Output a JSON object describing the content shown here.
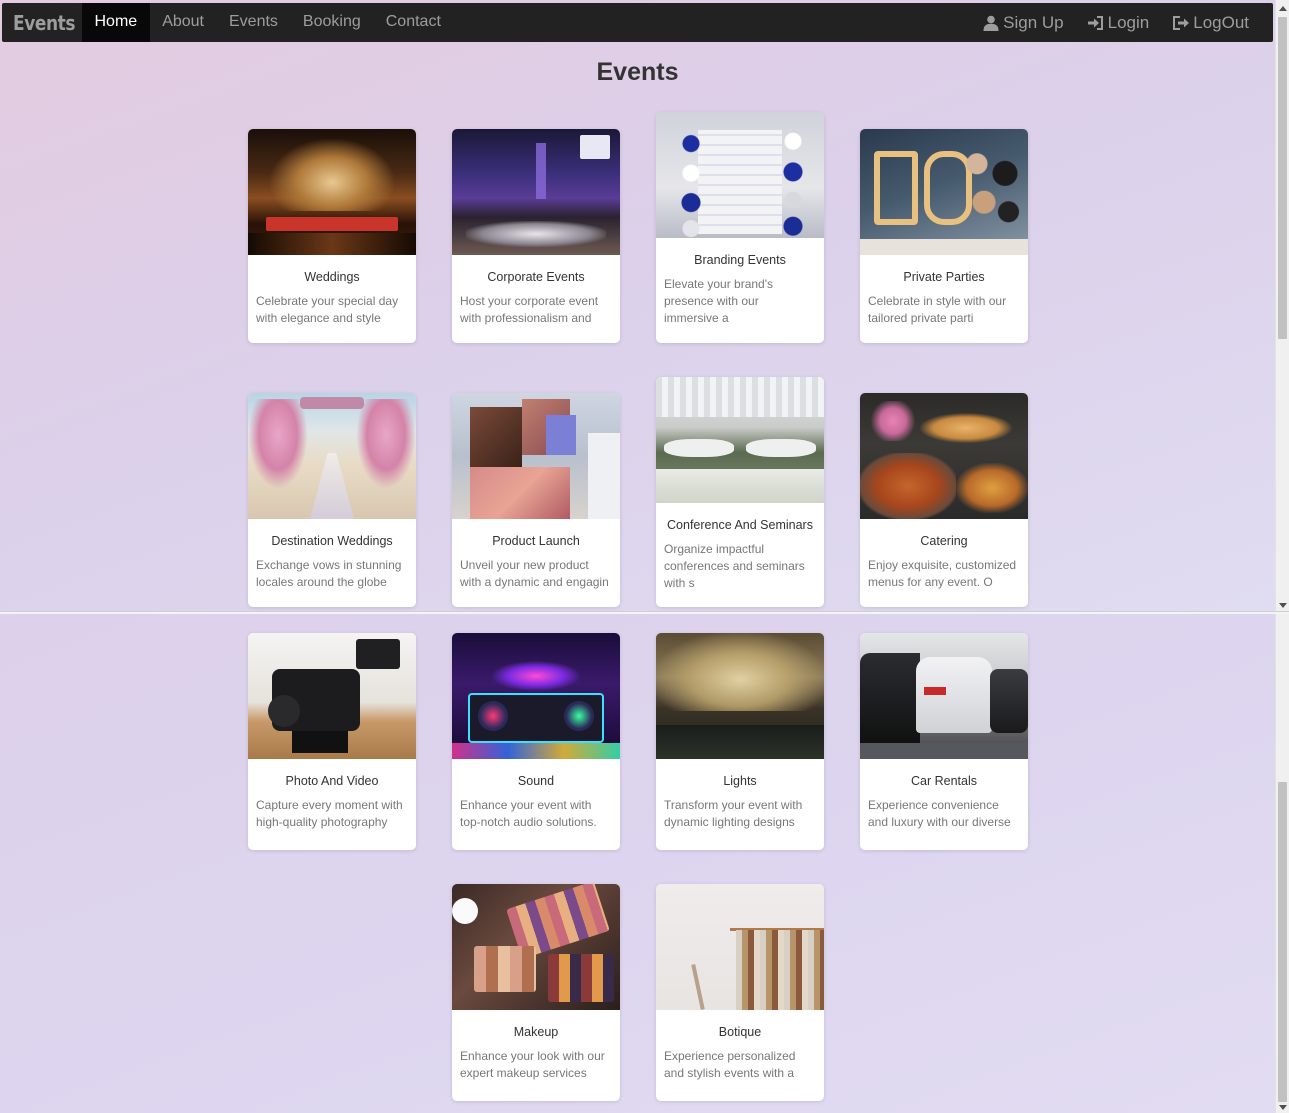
{
  "nav": {
    "brand": "Events",
    "links": [
      "Home",
      "About",
      "Events",
      "Booking",
      "Contact"
    ],
    "active": "Home",
    "right": [
      {
        "label": "Sign Up",
        "icon": "user-icon"
      },
      {
        "label": "Login",
        "icon": "login-icon"
      },
      {
        "label": "LogOut",
        "icon": "logout-icon"
      }
    ]
  },
  "page": {
    "title": "Events"
  },
  "cards": [
    {
      "title": "Weddings",
      "desc": "Celebrate your special day with elegance and style",
      "image": "wedding-stage-image"
    },
    {
      "title": "Corporate Events",
      "desc": "Host your corporate event with professionalism and",
      "image": "corporate-hall-image"
    },
    {
      "title": "Branding Events",
      "desc": "Elevate your brand's presence with our immersive a",
      "image": "balloon-backdrop-image"
    },
    {
      "title": "Private Parties",
      "desc": "Celebrate in style with our tailored private parti",
      "image": "party-balloons-image"
    },
    {
      "title": "Destination Weddings",
      "desc": "Exchange vows in stunning locales around the globe",
      "image": "beach-wedding-image"
    },
    {
      "title": "Product Launch",
      "desc": "Unveil your new product with a dynamic and engagin",
      "image": "product-launch-image"
    },
    {
      "title": "Conference And Seminars",
      "desc": "Organize impactful conferences and seminars with s",
      "image": "conference-room-image"
    },
    {
      "title": "Catering",
      "desc": "Enjoy exquisite, customized menus for any event. O",
      "image": "catering-buffet-image"
    },
    {
      "title": "Photo And Video",
      "desc": "Capture every moment with high-quality photography",
      "image": "camera-rig-image"
    },
    {
      "title": "Sound",
      "desc": "Enhance your event with top-notch audio solutions.",
      "image": "dj-booth-image"
    },
    {
      "title": "Lights",
      "desc": "Transform your event with dynamic lighting designs",
      "image": "fairy-lights-image"
    },
    {
      "title": "Car Rentals",
      "desc": "Experience convenience and luxury with our diverse",
      "image": "parked-cars-image"
    },
    {
      "title": "Makeup",
      "desc": "Enhance your look with our expert makeup services",
      "image": "makeup-palette-image"
    },
    {
      "title": "Botique",
      "desc": "Experience personalized and stylish events with a",
      "image": "clothing-rack-image"
    }
  ],
  "colors": {
    "navbar": "#222222",
    "nav_text": "#9d9d9d",
    "nav_active_bg": "#080808",
    "page_bg": "#ddd0ea"
  }
}
